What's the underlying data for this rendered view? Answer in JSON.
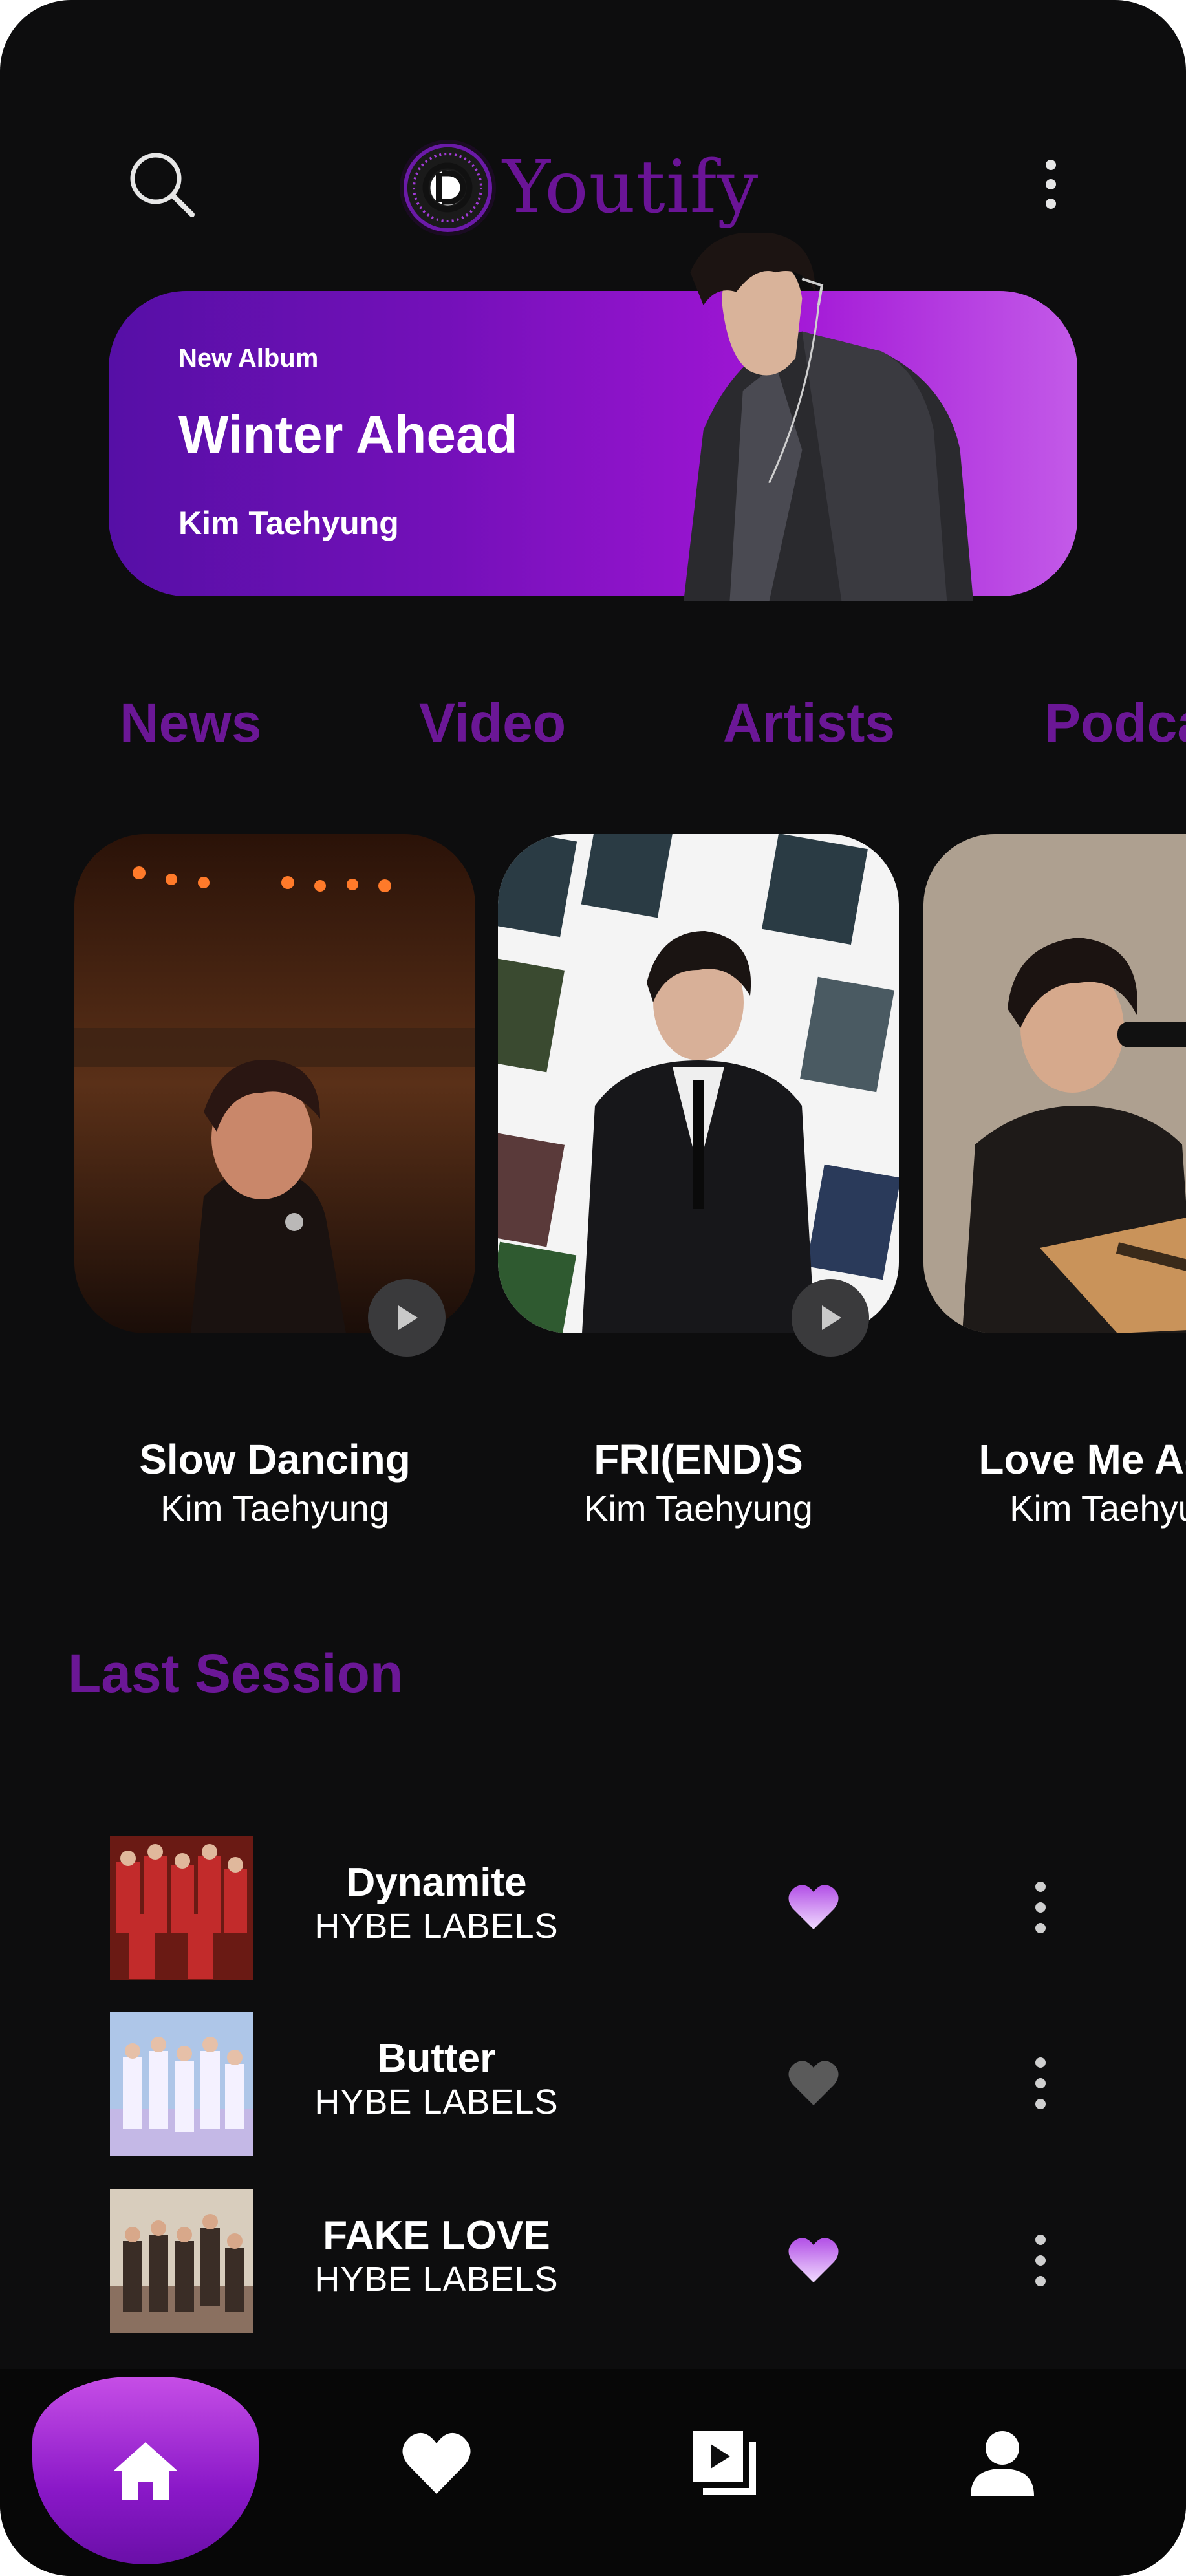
{
  "app": {
    "name": "Youtify"
  },
  "header": {
    "search_icon": "search-icon",
    "more_icon": "more-vertical-icon"
  },
  "banner": {
    "tag": "New Album",
    "title": "Winter Ahead",
    "artist": "Kim Taehyung"
  },
  "tabs": [
    {
      "label": "News",
      "active": true
    },
    {
      "label": "Video",
      "active": false
    },
    {
      "label": "Artists",
      "active": false
    },
    {
      "label": "Podcasts",
      "active": false
    }
  ],
  "featured": [
    {
      "title": "Slow Dancing",
      "artist": "Kim Taehyung"
    },
    {
      "title": "FRI(END)S",
      "artist": "Kim Taehyung"
    },
    {
      "title": "Love Me Again",
      "artist": "Kim Taehyung"
    }
  ],
  "last_session": {
    "title": "Last Session",
    "tracks": [
      {
        "title": "Dynamite",
        "artist": "HYBE LABELS",
        "liked": true
      },
      {
        "title": "Butter",
        "artist": "HYBE LABELS",
        "liked": false
      },
      {
        "title": "FAKE LOVE",
        "artist": "HYBE LABELS",
        "liked": true
      }
    ]
  },
  "nav": [
    {
      "icon": "home-icon",
      "active": true
    },
    {
      "icon": "heart-icon",
      "active": false
    },
    {
      "icon": "playlist-icon",
      "active": false
    },
    {
      "icon": "profile-icon",
      "active": false
    }
  ],
  "colors": {
    "accent": "#6b1796",
    "background": "#0d0d0e",
    "liked": "#b24fe6",
    "unliked": "#5a5a5a"
  }
}
